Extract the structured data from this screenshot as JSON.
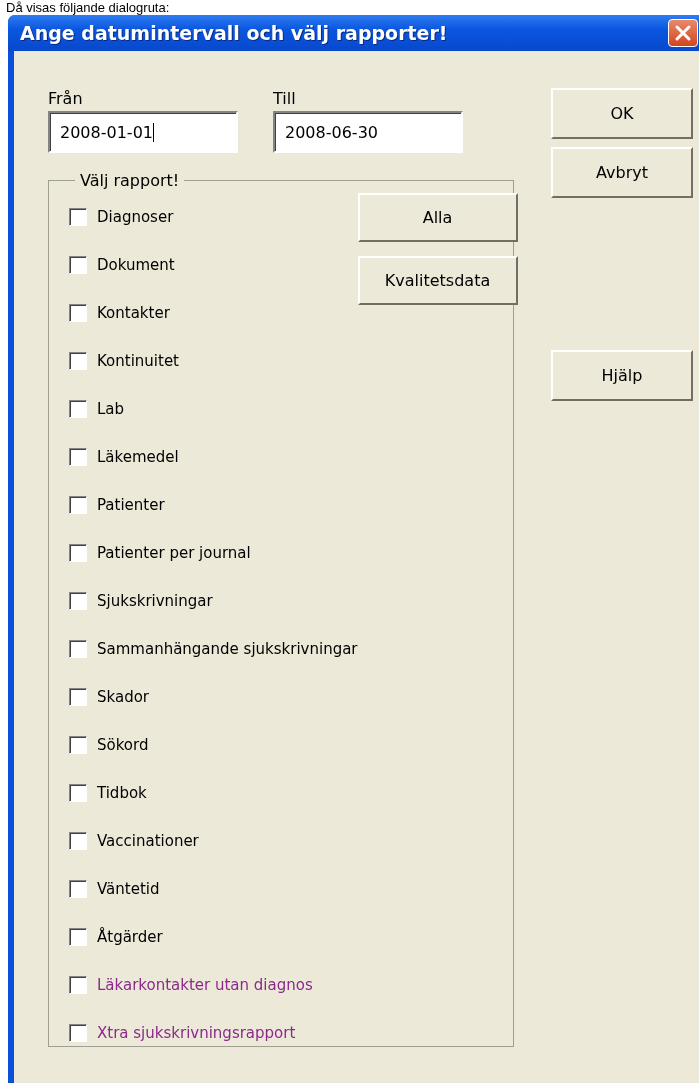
{
  "caption": "Då visas följande dialogruta:",
  "window": {
    "title": "Ange datumintervall och välj rapporter!"
  },
  "fields": [
    {
      "label": "Från",
      "value": "2008-01-01",
      "focused": true
    },
    {
      "label": "Till",
      "value": "2008-06-30",
      "focused": false
    }
  ],
  "group": {
    "legend": "Välj rapport!"
  },
  "reports": [
    {
      "label": "Diagnoser",
      "checked": false,
      "kind": "standard"
    },
    {
      "label": "Dokument",
      "checked": false,
      "kind": "standard"
    },
    {
      "label": "Kontakter",
      "checked": false,
      "kind": "standard"
    },
    {
      "label": "Kontinuitet",
      "checked": false,
      "kind": "standard"
    },
    {
      "label": "Lab",
      "checked": false,
      "kind": "standard"
    },
    {
      "label": "Läkemedel",
      "checked": false,
      "kind": "standard"
    },
    {
      "label": "Patienter",
      "checked": false,
      "kind": "standard"
    },
    {
      "label": "Patienter per journal",
      "checked": false,
      "kind": "standard"
    },
    {
      "label": "Sjukskrivningar",
      "checked": false,
      "kind": "standard"
    },
    {
      "label": "Sammanhängande sjukskrivningar",
      "checked": false,
      "kind": "standard"
    },
    {
      "label": "Skador",
      "checked": false,
      "kind": "standard"
    },
    {
      "label": "Sökord",
      "checked": false,
      "kind": "standard"
    },
    {
      "label": "Tidbok",
      "checked": false,
      "kind": "standard"
    },
    {
      "label": "Vaccinationer",
      "checked": false,
      "kind": "standard"
    },
    {
      "label": "Väntetid",
      "checked": false,
      "kind": "standard"
    },
    {
      "label": "Åtgärder",
      "checked": false,
      "kind": "standard"
    },
    {
      "label": "Läkarkontakter utan diagnos",
      "checked": false,
      "kind": "extra"
    },
    {
      "label": "Xtra sjukskrivningsrapport",
      "checked": false,
      "kind": "extra"
    }
  ],
  "group_buttons": [
    "Alla",
    "Kvalitetsdata"
  ],
  "side_buttons": [
    "OK",
    "Avbryt",
    "Hjälp"
  ]
}
